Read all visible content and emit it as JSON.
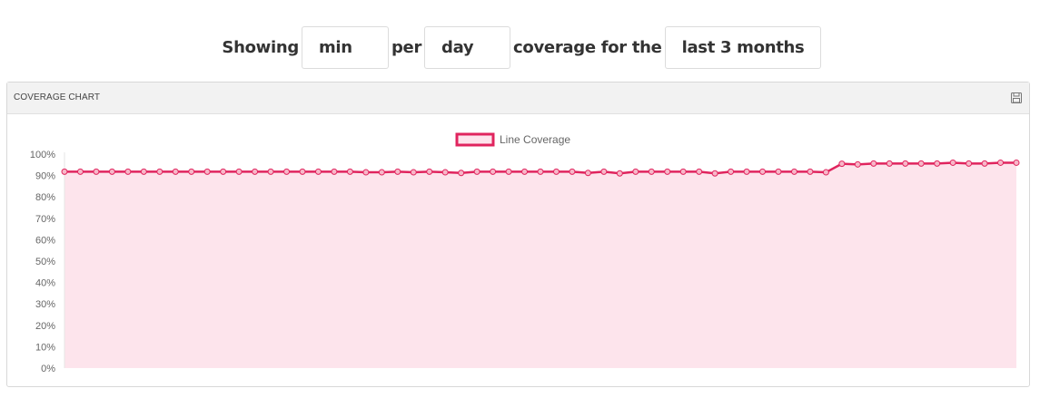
{
  "filters": {
    "showing_label": "Showing",
    "per_label": "per",
    "coverage_label": "coverage for the",
    "metric_value": "min",
    "period_value": "day",
    "range_value": "last 3 months"
  },
  "panel": {
    "title": "COVERAGE CHART",
    "save_icon": "floppy-disk-icon"
  },
  "colors": {
    "line": "#e0245e",
    "fill": "#fde4ec",
    "point_fill": "#f7b7c8",
    "text": "#333333"
  },
  "chart_data": {
    "type": "area",
    "title": "",
    "xlabel": "",
    "ylabel": "",
    "ylim": [
      0,
      100
    ],
    "y_ticks": [
      "0%",
      "10%",
      "20%",
      "30%",
      "40%",
      "50%",
      "60%",
      "70%",
      "80%",
      "90%",
      "100%"
    ],
    "legend_position": "top-center",
    "grid": false,
    "series": [
      {
        "name": "Line Coverage",
        "values": [
          91.8,
          91.8,
          91.8,
          91.8,
          91.8,
          91.8,
          91.8,
          91.8,
          91.8,
          91.8,
          91.8,
          91.8,
          91.8,
          91.8,
          91.8,
          91.8,
          91.8,
          91.8,
          91.8,
          91.5,
          91.5,
          91.8,
          91.5,
          91.8,
          91.5,
          91.2,
          91.8,
          91.8,
          91.8,
          91.8,
          91.8,
          91.8,
          91.8,
          91.2,
          91.8,
          91.0,
          91.8,
          91.8,
          91.8,
          91.8,
          91.8,
          91.0,
          91.8,
          91.8,
          91.8,
          91.8,
          91.8,
          91.8,
          91.5,
          95.5,
          95.2,
          95.6,
          95.6,
          95.6,
          95.6,
          95.6,
          96.0,
          95.6,
          95.6,
          96.0,
          96.0
        ]
      }
    ]
  }
}
